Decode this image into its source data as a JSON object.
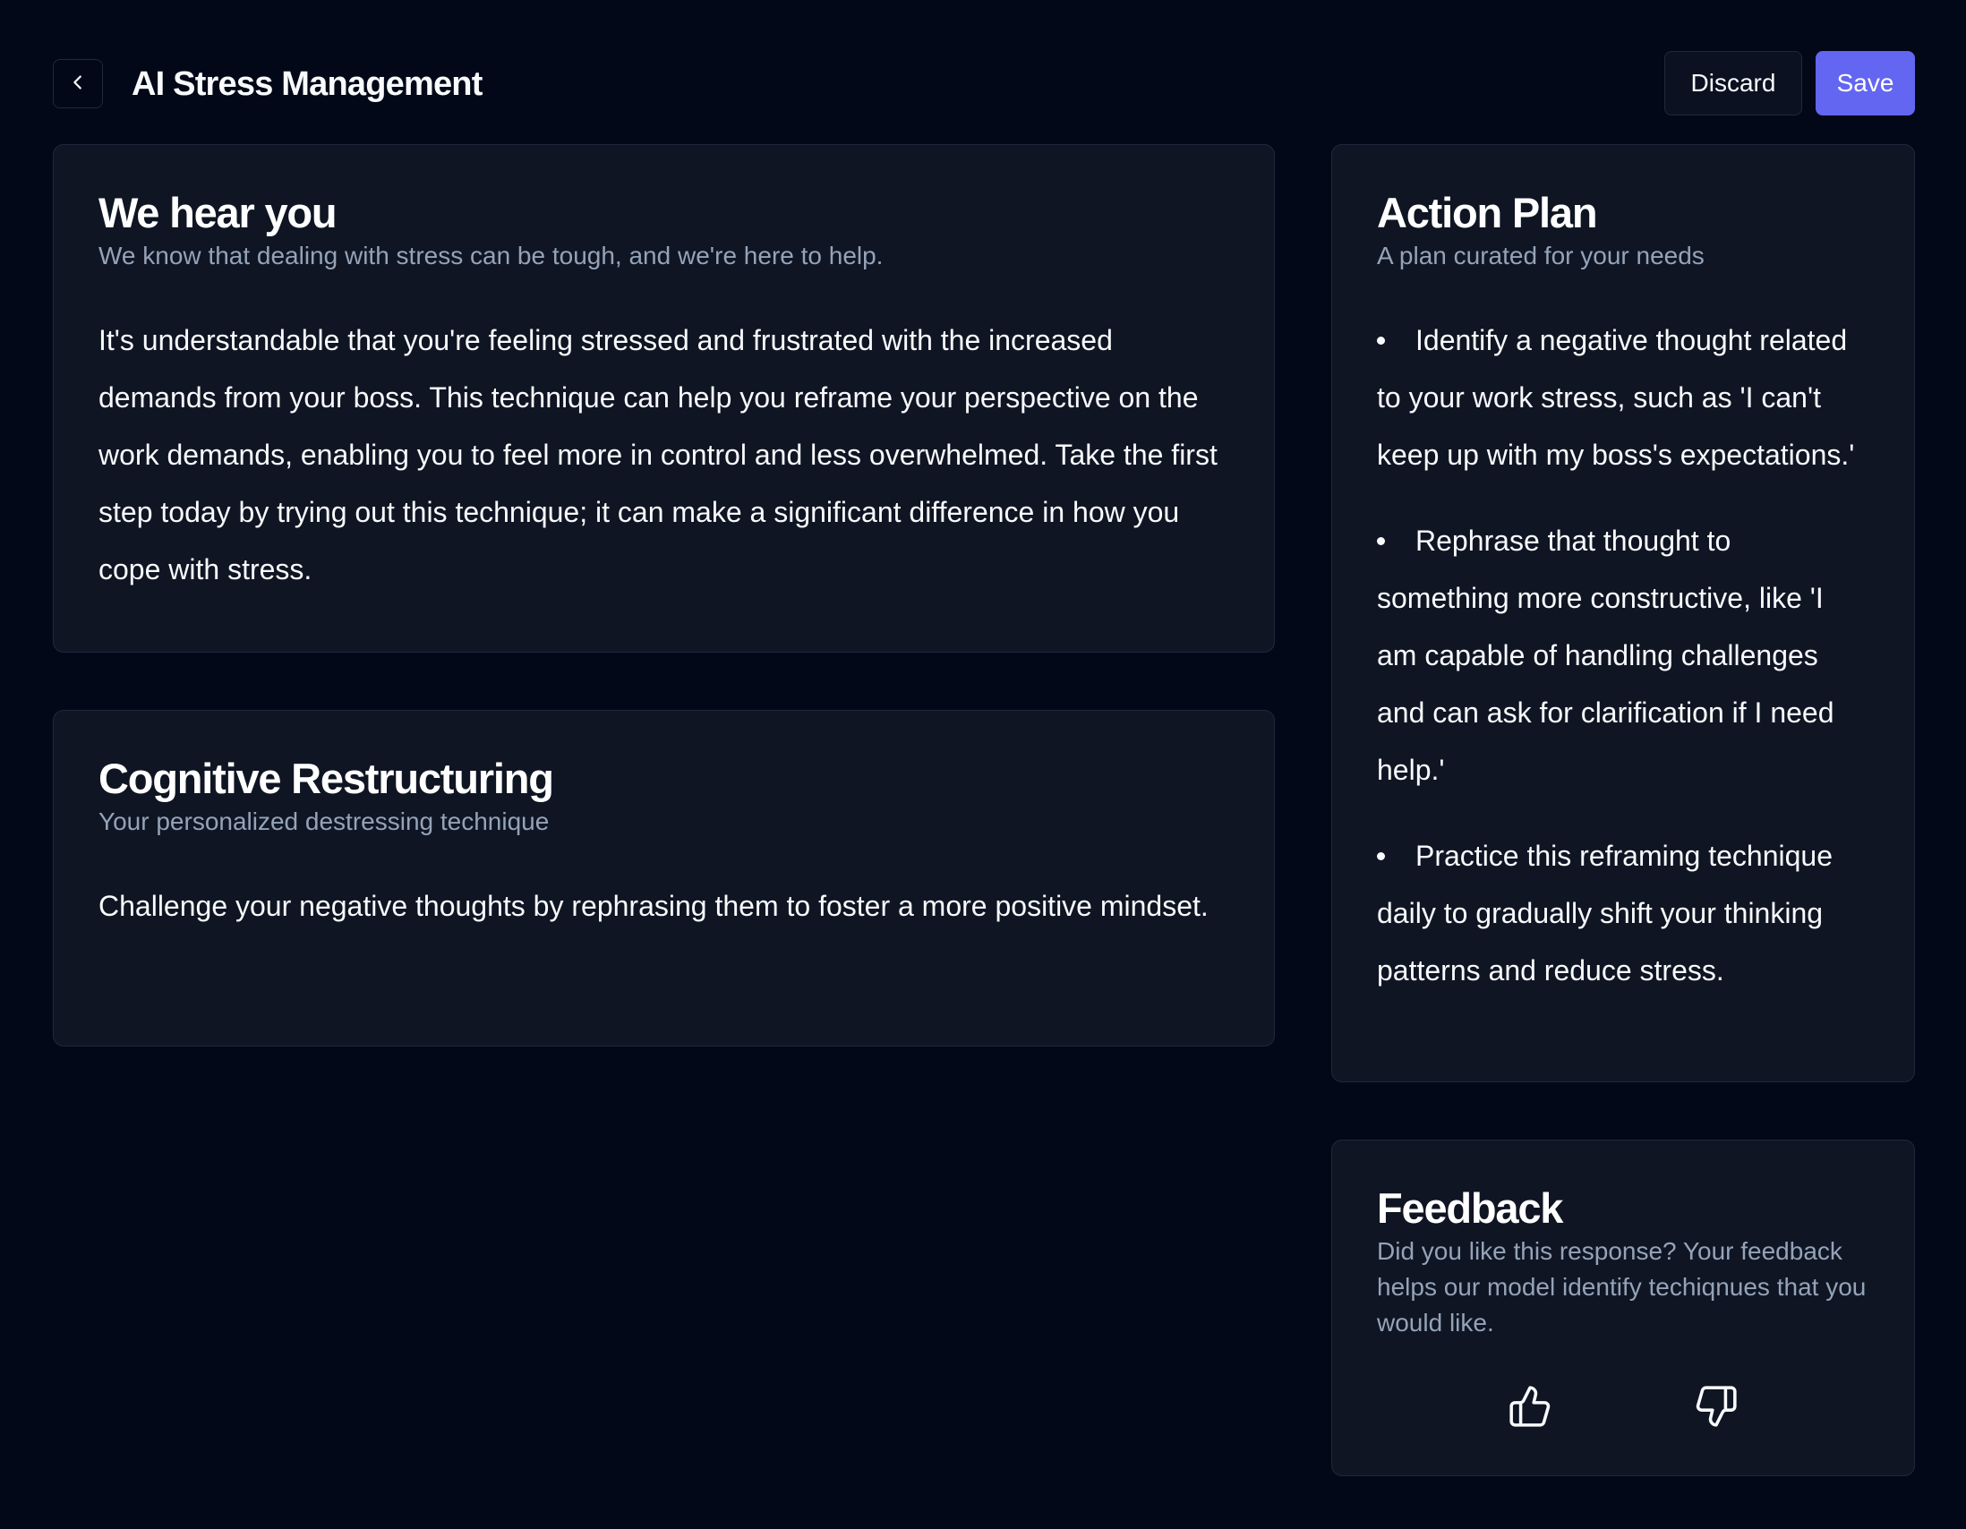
{
  "header": {
    "title": "AI Stress Management",
    "discard_label": "Discard",
    "save_label": "Save",
    "back_icon": "chevron-left-icon"
  },
  "colors": {
    "background": "#020817",
    "card_background": "#0f1523",
    "border": "#1e293b",
    "accent": "#6366f1",
    "muted_text": "#94a3b8"
  },
  "hear_card": {
    "title": "We hear you",
    "subtitle": "We know that dealing with stress can be tough, and we're here to help.",
    "body": "It's understandable that you're feeling stressed and frustrated with the increased demands from your boss. This technique can help you reframe your perspective on the work demands, enabling you to feel more in control and less overwhelmed. Take the first step today by trying out this technique; it can make a significant difference in how you cope with stress."
  },
  "technique_card": {
    "title": "Cognitive Restructuring",
    "subtitle": "Your personalized destressing technique",
    "body": "Challenge your negative thoughts by rephrasing them to foster a more positive mindset."
  },
  "action_plan": {
    "title": "Action Plan",
    "subtitle": "A plan curated for your needs",
    "steps": [
      "Identify a negative thought related to your work stress, such as 'I can't keep up with my boss's expectations.'",
      "Rephrase that thought to something more constructive, like 'I am capable of handling challenges and can ask for clarification if I need help.'",
      "Practice this reframing technique daily to gradually shift your thinking patterns and reduce stress."
    ]
  },
  "feedback": {
    "title": "Feedback",
    "subtitle": "Did you like this response? Your feedback helps our model identify techiqnues that you would like.",
    "like_icon": "thumbs-up-icon",
    "dislike_icon": "thumbs-down-icon"
  }
}
